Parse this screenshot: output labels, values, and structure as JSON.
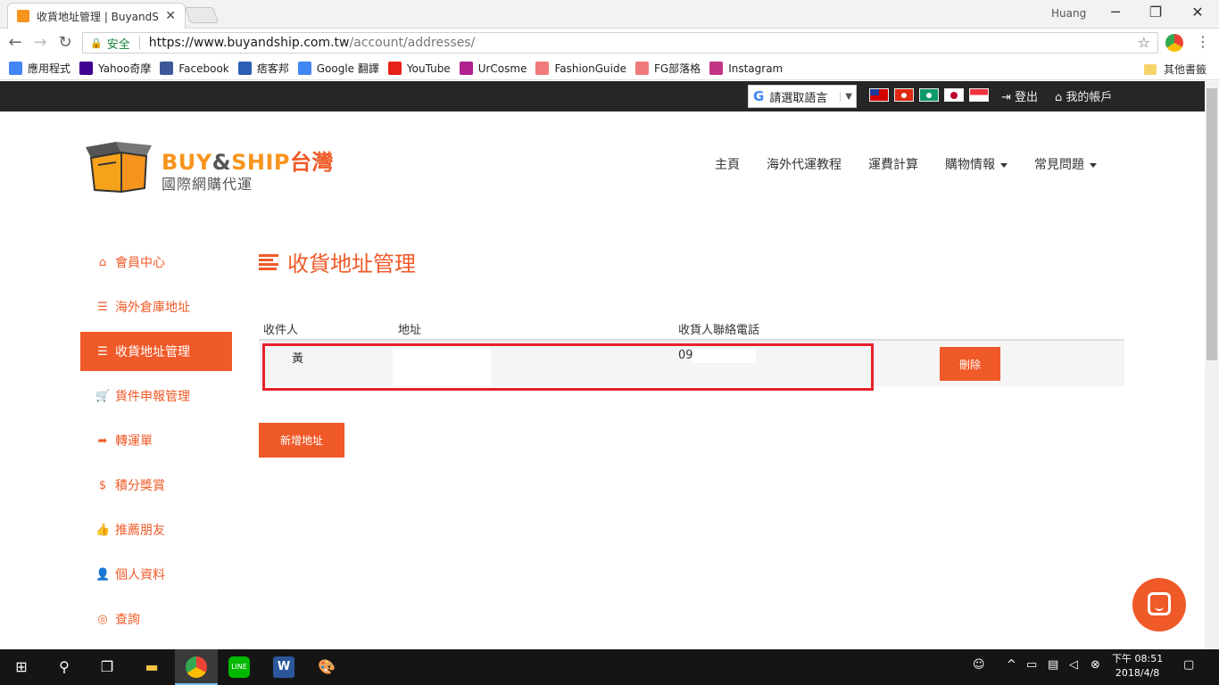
{
  "browser": {
    "tab_title": "收貨地址管理 | BuyandS",
    "tab_close": "✕",
    "user": "Huang",
    "minimize": "─",
    "restore": "❐",
    "close": "✕",
    "secure_label": "安全",
    "url_host": "https://www.buyandship.com.tw",
    "url_path": "/account/addresses/",
    "bookmarks": [
      {
        "label": "應用程式",
        "icon": "apps-grid-icon",
        "color": "#4285f4"
      },
      {
        "label": "Yahoo奇摩",
        "icon": "yahoo-icon",
        "color": "#400090"
      },
      {
        "label": "Facebook",
        "icon": "facebook-icon",
        "color": "#3b5998"
      },
      {
        "label": "痞客邦",
        "icon": "pixnet-icon",
        "color": "#2b5fb4"
      },
      {
        "label": "Google 翻譯",
        "icon": "google-translate-icon",
        "color": "#4285f4"
      },
      {
        "label": "YouTube",
        "icon": "youtube-icon",
        "color": "#e62117"
      },
      {
        "label": "UrCosme",
        "icon": "urcosme-icon",
        "color": "#b0208e"
      },
      {
        "label": "FashionGuide",
        "icon": "fashionguide-icon",
        "color": "#f07b7b"
      },
      {
        "label": "FG部落格",
        "icon": "fg-blog-icon",
        "color": "#f07b7b"
      },
      {
        "label": "Instagram",
        "icon": "instagram-icon",
        "color": "#c13584"
      }
    ],
    "other_bookmarks": "其他書籤"
  },
  "topbar": {
    "translate_label": "請選取語言",
    "translate_arrow": "▼",
    "logout": "登出",
    "my_account": "我的帳戶",
    "flags": [
      "taiwan-flag",
      "hongkong-flag",
      "macau-flag",
      "japan-flag",
      "singapore-flag"
    ]
  },
  "header": {
    "logo_buy": "BUY",
    "logo_and": "&",
    "logo_ship": "SHIP",
    "logo_tw": "台灣",
    "logo_sub": "國際網購代運",
    "nav": [
      "主頁",
      "海外代運教程",
      "運費計算",
      "購物情報",
      "常見問題"
    ]
  },
  "sidebar": {
    "items": [
      {
        "label": "會員中心",
        "icon": "home-icon",
        "active": false
      },
      {
        "label": "海外倉庫地址",
        "icon": "list-icon",
        "active": false
      },
      {
        "label": "收貨地址管理",
        "icon": "list-icon",
        "active": true
      },
      {
        "label": "貨件申報管理",
        "icon": "cart-icon",
        "active": false
      },
      {
        "label": "轉運單",
        "icon": "share-icon",
        "active": false
      },
      {
        "label": "積分獎賞",
        "icon": "dollar-icon",
        "active": false
      },
      {
        "label": "推薦朋友",
        "icon": "thumbs-up-icon",
        "active": false
      },
      {
        "label": "個人資料",
        "icon": "user-icon",
        "active": false
      },
      {
        "label": "查詢",
        "icon": "lifebuoy-icon",
        "active": false
      }
    ]
  },
  "main": {
    "title": "收貨地址管理",
    "table": {
      "headers": [
        "收件人",
        "地址",
        "收貨人聯絡電話"
      ],
      "rows": [
        {
          "recipient": "黃",
          "address": "",
          "phone": "09",
          "delete_label": "刪除"
        }
      ]
    },
    "add_button": "新增地址"
  },
  "taskbar": {
    "time": "下午 08:51",
    "date": "2018/4/8"
  },
  "colors": {
    "accent": "#f05a28",
    "logo_orange": "#f7941d",
    "highlight_red": "#e8202a",
    "topbar_dark": "#262626"
  }
}
